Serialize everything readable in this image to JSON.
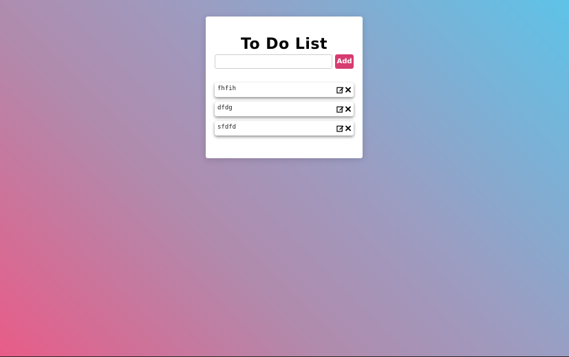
{
  "app": {
    "title": "To Do List"
  },
  "form": {
    "input_value": "",
    "input_placeholder": "",
    "add_label": "Add"
  },
  "todos": [
    {
      "text": "fhfih"
    },
    {
      "text": "dfdg"
    },
    {
      "text": "sfdfd"
    }
  ],
  "colors": {
    "accent": "#d63c6f",
    "gradient_start": "#e85c88",
    "gradient_end": "#5ec3e8"
  },
  "icons": {
    "edit": "edit-icon",
    "delete": "close-icon"
  }
}
